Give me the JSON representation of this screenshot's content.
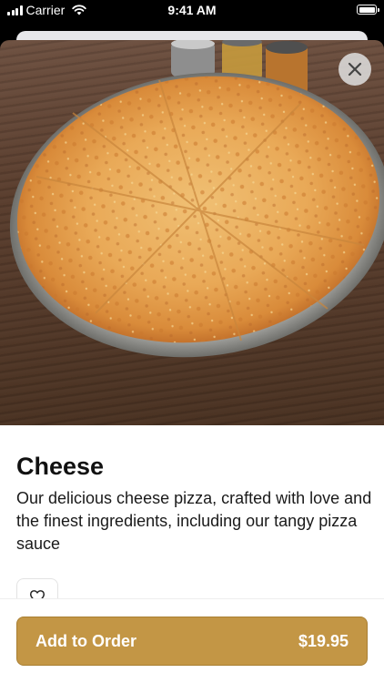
{
  "status_bar": {
    "carrier": "Carrier",
    "time": "9:41 AM"
  },
  "item": {
    "name": "Cheese",
    "description": "Our delicious cheese pizza, crafted with love and the finest ingredients, including our tangy pizza sauce"
  },
  "footer": {
    "button_label": "Add to Order",
    "price": "$19.95"
  },
  "colors": {
    "accent": "#c39645",
    "close_bg": "#e1e1e1"
  }
}
